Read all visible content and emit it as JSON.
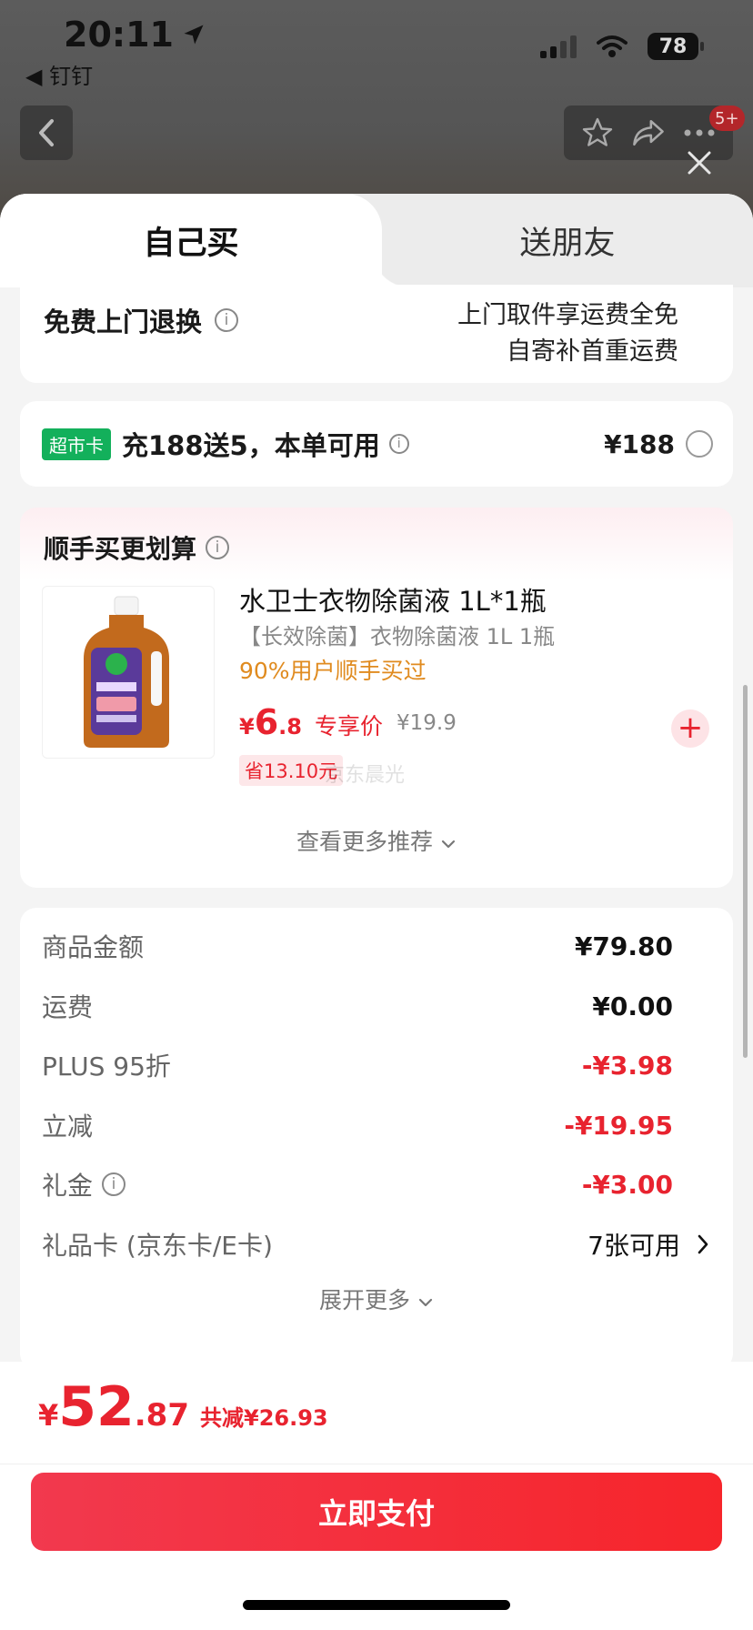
{
  "status_bar": {
    "time": "20:11",
    "back_app": "◀ 钉钉",
    "battery": "78"
  },
  "nav": {
    "badge": "5+"
  },
  "tabs": {
    "self": "自己买",
    "gift": "送朋友"
  },
  "return_service": {
    "title": "免费上门退换",
    "line1": "上门取件享运费全免",
    "line2": "自寄补首重运费"
  },
  "supermarket_card": {
    "badge": "超市卡",
    "text": "充188送5，本单可用",
    "price": "¥188"
  },
  "recommend": {
    "title": "顺手买更划算",
    "product_name": "水卫士衣物除菌液 1L*1瓶",
    "product_sub": "【长效除菌】衣物除菌液 1L 1瓶",
    "hint": "90%用户顺手买过",
    "price_currency": "¥",
    "price_int": "6",
    "price_dec": ".8",
    "price_tag": "专享价",
    "original_price": "¥19.9",
    "save_text": "省13.10元",
    "watermark": "京东晨光",
    "more": "查看更多推荐"
  },
  "summary": {
    "rows": [
      {
        "label": "商品金额",
        "value": "¥79.80"
      },
      {
        "label": "运费",
        "value": "¥0.00"
      },
      {
        "label": "PLUS 95折",
        "value": "-¥3.98"
      },
      {
        "label": "立减",
        "value": "-¥19.95"
      },
      {
        "label": "礼金",
        "value": "-¥3.00"
      },
      {
        "label": "礼品卡 (京东卡/E卡)",
        "value": "7张可用"
      }
    ],
    "expand": "展开更多"
  },
  "footer": {
    "currency": "¥",
    "total_int": "52",
    "total_dec": ".87",
    "reduce": "共减¥26.93",
    "pay_button": "立即支付"
  },
  "colors": {
    "accent_red": "#e8232f",
    "supermarket_green": "#13b05b",
    "hint_orange": "#e08b1f"
  }
}
